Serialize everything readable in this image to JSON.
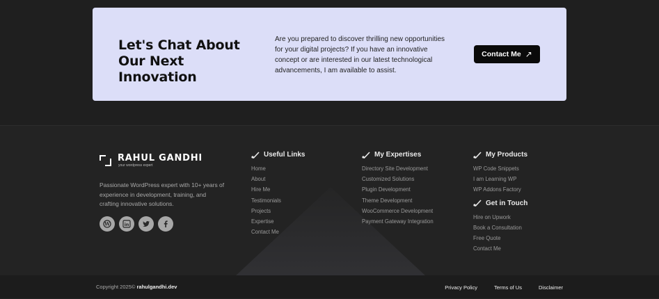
{
  "cta": {
    "title": "Let's Chat About Our Next Innovation",
    "text": "Are you prepared to discover thrilling new opportunities for your digital projects? If you have an innovative concept or are interested in our latest technological advancements, I am available to assist.",
    "button_label": "Contact Me",
    "button_icon": "arrow-up-right-icon"
  },
  "brand": {
    "name": "RAHUL GANDHI",
    "tagline": "your wordpress expert",
    "about": "Passionate WordPress expert with 10+ years of experience in development, training, and crafting innovative solutions.",
    "socials": [
      "wordpress-icon",
      "linkedin-icon",
      "twitter-icon",
      "facebook-icon"
    ]
  },
  "useful_links": {
    "title": "Useful Links",
    "items": [
      "Home",
      "About",
      "Hire Me",
      "Testimonials",
      "Projects",
      "Expertise",
      "Contact Me"
    ]
  },
  "expertises": {
    "title": "My Expertises",
    "items": [
      "Directory Site Development",
      "Customized Solutions",
      "Plugin Development",
      "Theme Development",
      "WooCommerce Development",
      "Payment Gateway Integration"
    ]
  },
  "products": {
    "title": "My Products",
    "items": [
      "WP Code Snippets",
      "I am Learning WP",
      "WP Addons Factory"
    ]
  },
  "get_in_touch": {
    "title": "Get in Touch",
    "items": [
      "Hire on Upwork",
      "Book a Consultation",
      "Free Quote",
      "Contact Me"
    ]
  },
  "bottom": {
    "copyright_prefix": "Copyright 2025©",
    "site": "rahulgandhi.dev",
    "links": [
      "Privacy Policy",
      "Terms of Us",
      "Disclaimer"
    ]
  },
  "colors": {
    "background": "#1f1f1f",
    "cta_card": "#dcdef8",
    "button": "#0a0a0a"
  }
}
